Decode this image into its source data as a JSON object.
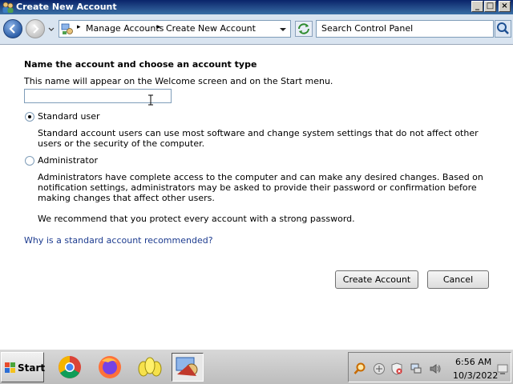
{
  "window": {
    "title": "Create New Account"
  },
  "address_bar": {
    "crumbs": [
      "Manage Accounts",
      "Create New Account"
    ],
    "search_placeholder": "Search Control Panel"
  },
  "form": {
    "heading": "Name the account and choose an account type",
    "description": "This name will appear on the Welcome screen and on the Start menu.",
    "account_name_value": "",
    "options": [
      {
        "label": "Standard user",
        "selected": true,
        "description": "Standard account users can use most software and change system settings that do not affect other users or the security of the computer."
      },
      {
        "label": "Administrator",
        "selected": false,
        "description": "Administrators have complete access to the computer and can make any desired changes. Based on notification settings, administrators may be asked to provide their password or confirmation before making changes that affect other users."
      }
    ],
    "recommendation": "We recommend that you protect every account with a strong password.",
    "help_link": "Why is a standard account recommended?",
    "create_button": "Create Account",
    "cancel_button": "Cancel"
  },
  "taskbar": {
    "start_label": "Start",
    "apps": [
      "chrome-icon",
      "firefox-icon",
      "users-icon",
      "control-panel-icon"
    ],
    "tray_icons": [
      "search-icon",
      "network-icon",
      "shield-icon",
      "monitor-icon",
      "volume-icon"
    ],
    "clock_time": "6:56 AM",
    "clock_date": "10/3/2022"
  },
  "colors": {
    "title_bar": "#0a246a",
    "link": "#1c3b8f",
    "address_bar_bg": "#d9e4f0"
  }
}
